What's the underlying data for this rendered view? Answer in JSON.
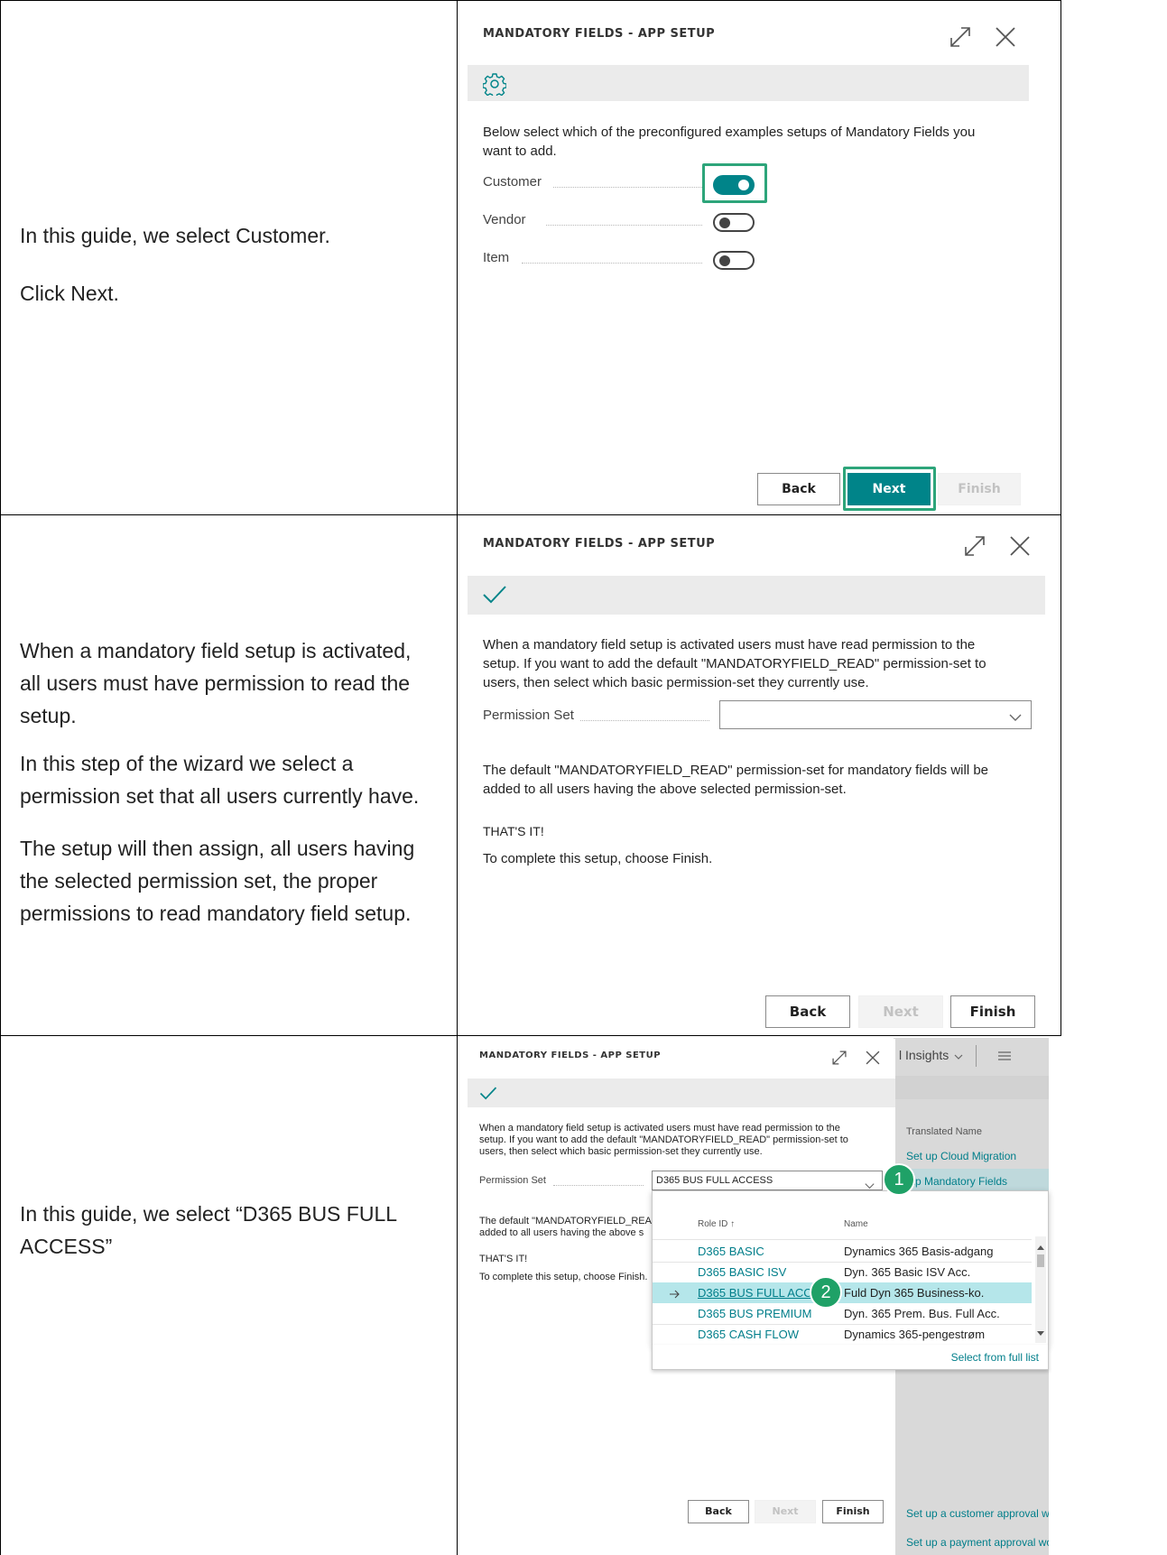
{
  "row1": {
    "guide": {
      "text1": "In this guide, we select Customer.",
      "text2": "Click Next."
    },
    "dialog": {
      "title": "MANDATORY FIELDS - APP SETUP",
      "intro": "Below select which of the preconfigured examples setups of Mandatory Fields you want to add.",
      "toggles": [
        {
          "label": "Customer",
          "on": true
        },
        {
          "label": "Vendor",
          "on": false
        },
        {
          "label": "Item",
          "on": false
        }
      ],
      "buttons": {
        "back": "Back",
        "next": "Next",
        "finish": "Finish"
      }
    }
  },
  "row2": {
    "guide": {
      "p1": "When a mandatory field setup is activated, all users must have permission to read the setup.",
      "p2": "In this step of the wizard we select a permission set that all users currently have.",
      "p3": "The setup will then assign, all users having the selected permission set, the proper permissions to read mandatory field setup."
    },
    "dialog": {
      "title": "MANDATORY FIELDS - APP SETUP",
      "intro": "When a mandatory field setup is activated users must have read permission to the setup. If you want to add the default \"MANDATORYFIELD_READ\" permission-set to users, then select which basic permission-set they currently use.",
      "permission_label": "Permission Set",
      "permission_value": "",
      "note": "The default \"MANDATORYFIELD_READ\" permission-set for mandatory fields will be added to all users having the above selected permission-set.",
      "thats_it": "THAT'S IT!",
      "complete": "To complete this setup, choose Finish.",
      "buttons": {
        "back": "Back",
        "next": "Next",
        "finish": "Finish"
      }
    }
  },
  "row3": {
    "guide": {
      "text": "In this guide, we select “D365 BUS FULL ACCESS”"
    },
    "background": {
      "insights": "l Insights",
      "translated_name": "Translated Name",
      "items": [
        "Set up Cloud Migration",
        "tup Mandatory Fields"
      ],
      "bottom_items": [
        "Set up a customer approval wo",
        "Set up a payment approval wor"
      ]
    },
    "dialog": {
      "title": "MANDATORY FIELDS - APP SETUP",
      "intro": "When a mandatory field setup is activated users must have read permission to the setup. If you want to add the default \"MANDATORYFIELD_READ\" permission-set to users, then select which basic permission-set they currently use.",
      "permission_label": "Permission Set",
      "permission_value": "D365 BUS FULL ACCESS",
      "note_partial_1": "The default \"MANDATORYFIELD_READ",
      "note_partial_2": "added to all users having the above s",
      "thats_it": "THAT'S IT!",
      "complete": "To complete this setup, choose Finish.",
      "buttons": {
        "back": "Back",
        "next": "Next",
        "finish": "Finish"
      }
    },
    "dropdown": {
      "col_role": "Role ID ↑",
      "col_name": "Name",
      "rows": [
        {
          "role": "D365 BASIC",
          "name": "Dynamics 365 Basis-adgang"
        },
        {
          "role": "D365 BASIC ISV",
          "name": "Dyn. 365 Basic ISV Acc."
        },
        {
          "role": "D365 BUS FULL ACCESS",
          "name": "Fuld Dyn 365 Business-ko.",
          "selected": true
        },
        {
          "role": "D365 BUS PREMIUM",
          "name": "Dyn. 365 Prem. Bus. Full Acc."
        },
        {
          "role": "D365 CASH FLOW",
          "name": "Dynamics 365-pengestrøm"
        }
      ],
      "footer_link": "Select from full list"
    },
    "badges": [
      "1",
      "2"
    ]
  },
  "colors": {
    "accent": "#008489",
    "highlight": "#2da57a",
    "badge": "#1fa167",
    "selected_row": "#b5e6ea"
  },
  "icons": [
    "settings-gear-icon",
    "expand-icon",
    "close-icon",
    "checkmark-icon",
    "chevron-down-icon",
    "hamburger-menu-icon",
    "arrow-right-icon",
    "scroll-up-icon",
    "scroll-down-icon"
  ]
}
